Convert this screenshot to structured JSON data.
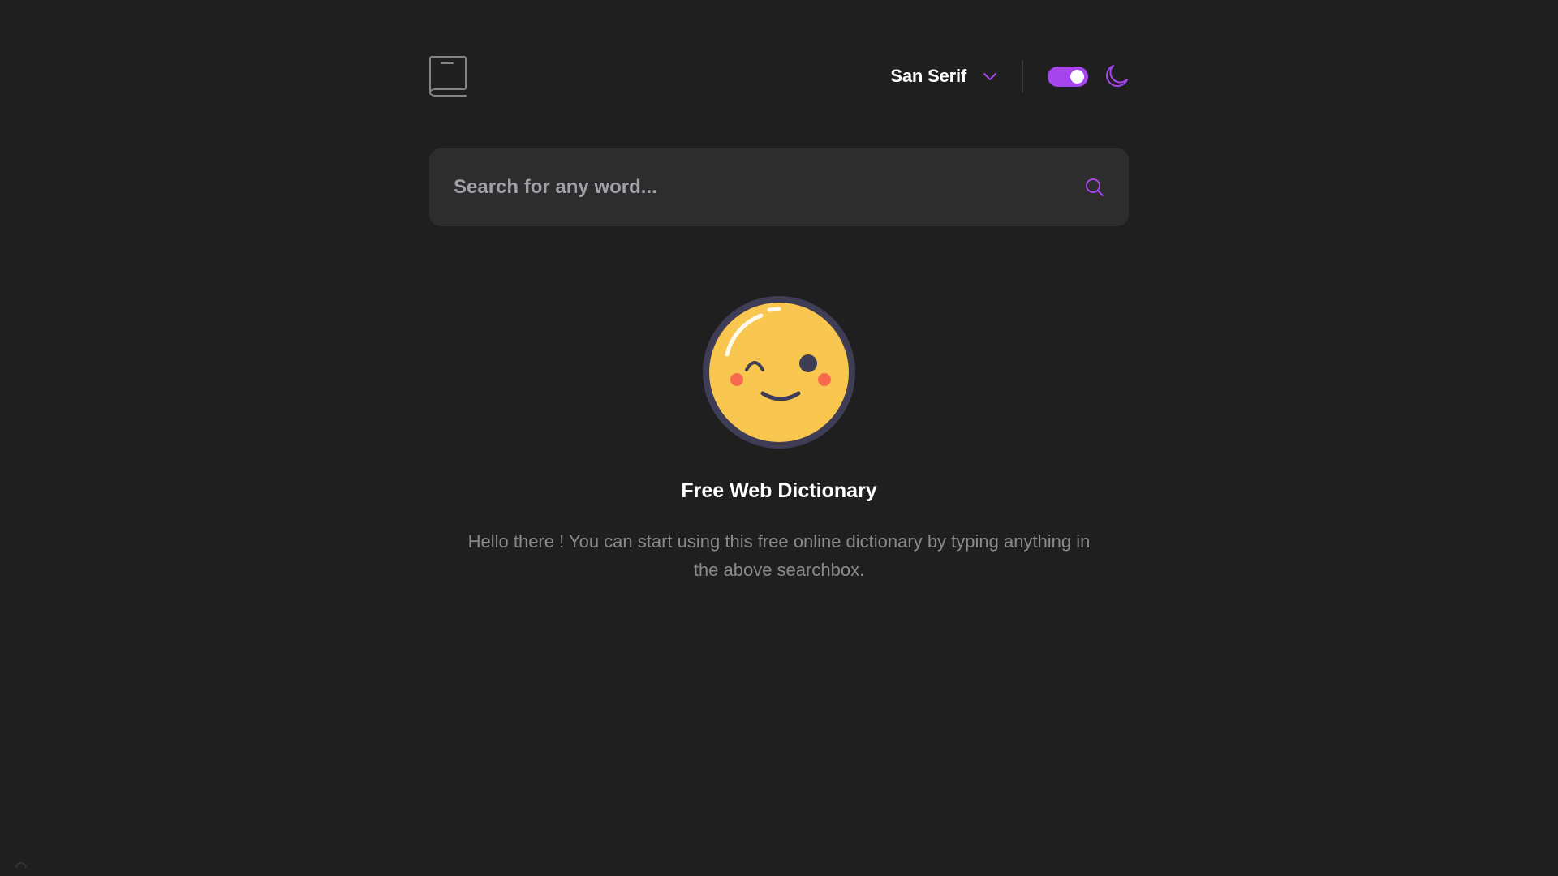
{
  "header": {
    "logo_icon": "book-icon",
    "font_selector": {
      "label": "San Serif",
      "icon": "chevron-down-icon"
    },
    "theme_toggle": {
      "state": "dark",
      "on": true,
      "icon": "moon-icon"
    }
  },
  "search": {
    "placeholder": "Search for any word...",
    "value": "",
    "icon": "search-icon"
  },
  "empty_state": {
    "icon": "smiling-emoji-icon",
    "title": "Free Web Dictionary",
    "message": "Hello there ! You can start using this free online dictionary by typing anything in the above searchbox."
  },
  "colors": {
    "background": "#1f1f1f",
    "surface": "#2d2d2d",
    "accent": "#a445ed",
    "text_primary": "#ffffff",
    "text_muted": "#8a8a8a",
    "emoji_face": "#f9c74f",
    "emoji_outline": "#3f3d56"
  }
}
